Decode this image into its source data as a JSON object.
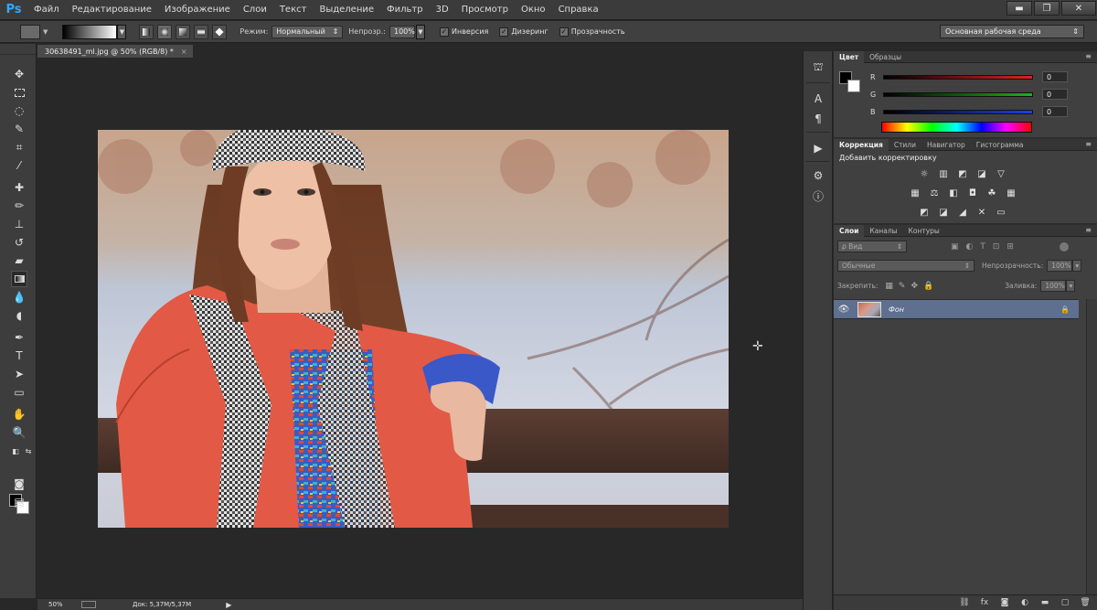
{
  "app": {
    "logo": "Ps",
    "menu": [
      "Файл",
      "Редактирование",
      "Изображение",
      "Слои",
      "Текст",
      "Выделение",
      "Фильтр",
      "3D",
      "Просмотр",
      "Окно",
      "Справка"
    ],
    "window_controls": {
      "minimize": "▬",
      "restore": "❐",
      "close": "✕"
    }
  },
  "options_bar": {
    "mode_label": "Режим:",
    "mode_value": "Нормальный",
    "opacity_label": "Непрозр.:",
    "opacity_value": "100%",
    "checkboxes": [
      {
        "label": "Инверсия",
        "checked": true
      },
      {
        "label": "Дизеринг",
        "checked": true
      },
      {
        "label": "Прозрачность",
        "checked": true
      }
    ],
    "workspace": "Основная рабочая среда"
  },
  "document": {
    "tab_title": "30638491_ml.jpg @ 50% (RGB/8) *",
    "tab_close": "×"
  },
  "status_bar": {
    "zoom": "50%",
    "doc_info": "Док: 5,37M/5,37M",
    "arrow": "▶"
  },
  "color_panel": {
    "tabs": [
      "Цвет",
      "Образцы"
    ],
    "channels": [
      {
        "name": "R",
        "value": "0",
        "color": "#e02020"
      },
      {
        "name": "G",
        "value": "0",
        "color": "#20b020"
      },
      {
        "name": "B",
        "value": "0",
        "color": "#2040e0"
      }
    ]
  },
  "adjustments_panel": {
    "tabs": [
      "Коррекция",
      "Стили",
      "Навигатор",
      "Гистограмма"
    ],
    "title": "Добавить корректировку"
  },
  "layers_panel": {
    "tabs": [
      "Слои",
      "Каналы",
      "Контуры"
    ],
    "filter_value": "ρ Вид",
    "blend_mode": "Обычные",
    "opacity_label": "Непрозрачность:",
    "opacity_value": "100%",
    "lock_label": "Закрепить:",
    "fill_label": "Заливка:",
    "fill_value": "100%",
    "layers": [
      {
        "name": "Фон",
        "visible": true,
        "locked": true
      }
    ]
  },
  "colors": {
    "accent": "#30a8ff",
    "selected_layer": "#5e6f8f",
    "panel_bg": "#404040",
    "canvas_bg": "#282828"
  }
}
